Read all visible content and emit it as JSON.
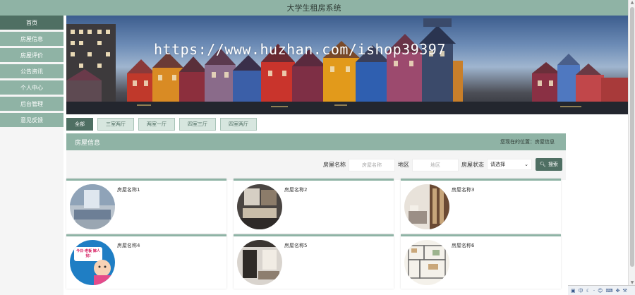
{
  "header": {
    "title": "大学生租房系统"
  },
  "sidebar": {
    "items": [
      {
        "label": "首页",
        "active": true
      },
      {
        "label": "房屋信息"
      },
      {
        "label": "房屋评价"
      },
      {
        "label": "公告资讯"
      },
      {
        "label": "个人中心"
      },
      {
        "label": "后台管理"
      },
      {
        "label": "意见反馈"
      }
    ]
  },
  "banner": {
    "watermark": "https://www.huzhan.com/ishop39397"
  },
  "tabs": [
    {
      "label": "全部",
      "active": true
    },
    {
      "label": "三室两厅"
    },
    {
      "label": "两室一厅"
    },
    {
      "label": "四室三厅"
    },
    {
      "label": "四室两厅"
    }
  ],
  "section": {
    "title": "房屋信息",
    "location": "您现在的位置：房屋信息"
  },
  "search": {
    "name_label": "房屋名称",
    "name_placeholder": "房屋名称",
    "area_label": "地区",
    "area_placeholder": "地区",
    "status_label": "房屋状态",
    "status_value": "请选择",
    "button_label": "搜索"
  },
  "listings": [
    {
      "name": "房屋名称1"
    },
    {
      "name": "房屋名称2"
    },
    {
      "name": "房屋名称3"
    },
    {
      "name": "房屋名称4",
      "image_caption": "今日·老板 嫁人找!"
    },
    {
      "name": "房屋名称5"
    },
    {
      "name": "房屋名称6"
    }
  ],
  "tray": {
    "ime": "中"
  },
  "colors": {
    "primary": "#8fb3a5",
    "dark": "#4f6f63",
    "light": "#d7e6df"
  }
}
